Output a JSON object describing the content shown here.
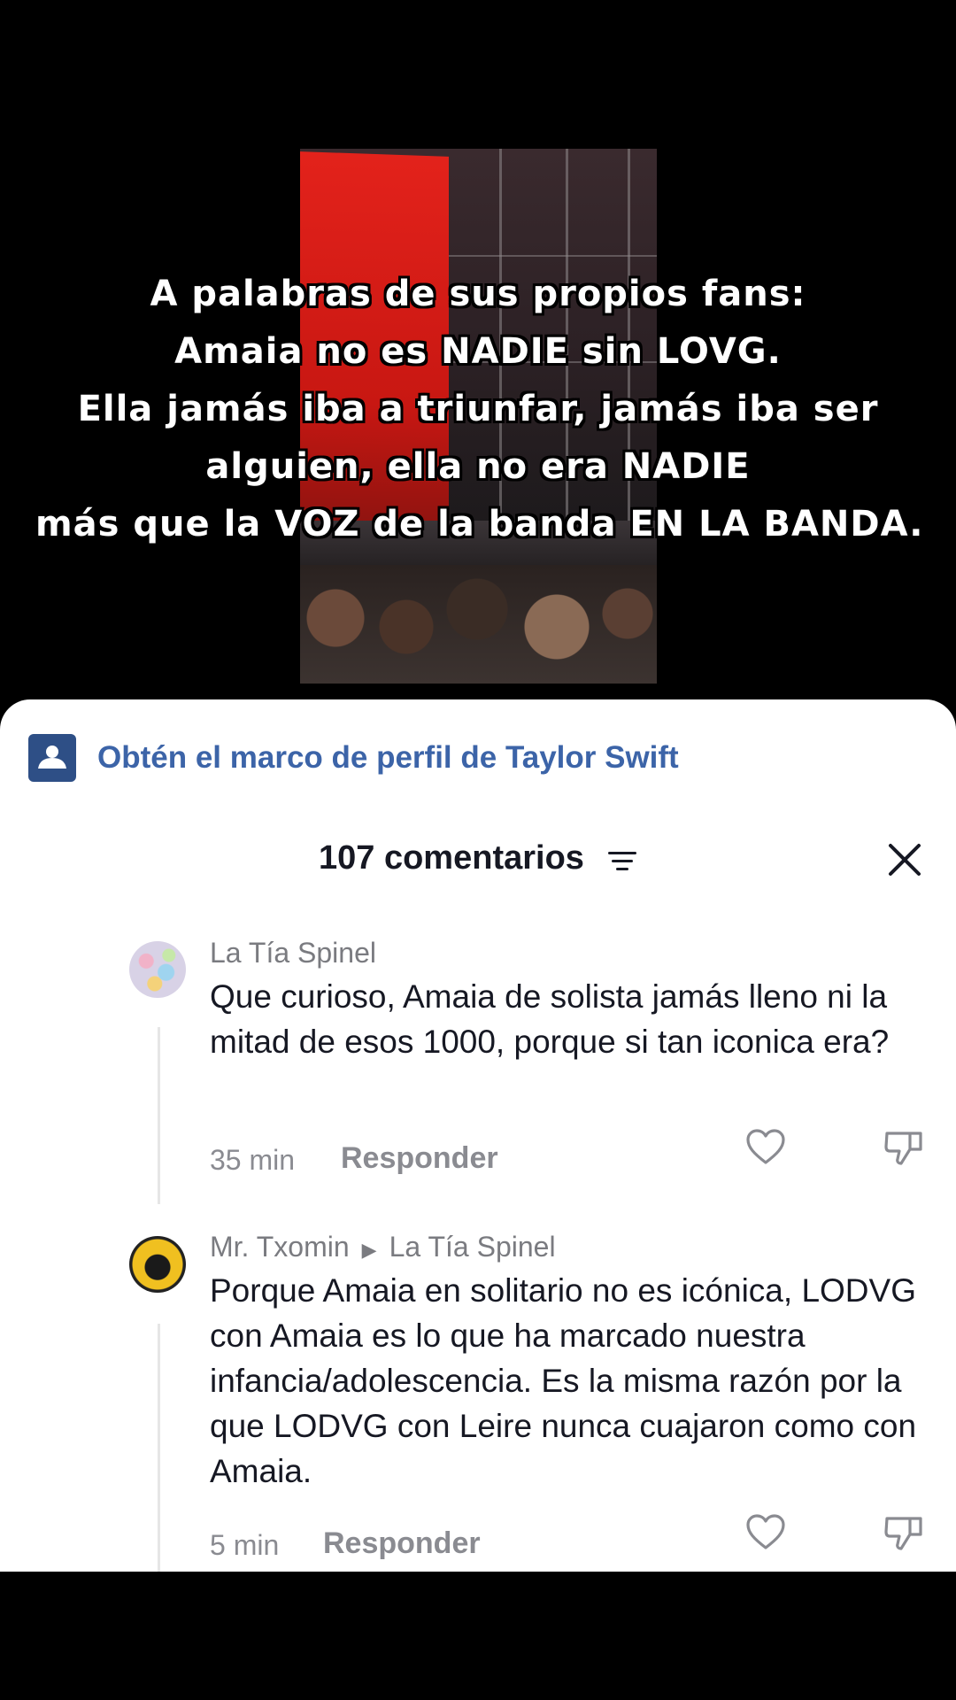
{
  "video": {
    "overlay_lines": [
      "A palabras de sus propios fans:",
      "Amaia no es NADIE sin LOVG.",
      "Ella jamás iba a triunfar, jamás iba ser",
      "alguien, ella no era NADIE",
      "más que la VOZ de la banda EN LA BANDA."
    ]
  },
  "promo": {
    "icon": "profile-frame-icon",
    "text": "Obtén el marco de perfil de Taylor Swift"
  },
  "header": {
    "title": "107 comentarios",
    "filter_icon": "filter-icon",
    "close_icon": "close-icon"
  },
  "comments": [
    {
      "username": "La Tía Spinel",
      "text": "Que curioso, Amaia de solista jamás lleno ni la mitad de esos 1000, porque si tan iconica era?",
      "time": "35 min",
      "reply_label": "Responder"
    },
    {
      "username": "Mr. Txomin",
      "reply_to": "La Tía Spinel",
      "text": "Porque Amaia en solitario no es icónica, LODVG con Amaia es lo que ha marcado nuestra infancia/adolescencia. Es la misma razón por la que LODVG con Leire nunca cuajaron como con Amaia.",
      "time": "5 min",
      "reply_label": "Responder"
    }
  ],
  "colors": {
    "promo_text": "#3c64a8",
    "promo_icon_bg": "#2e4f86",
    "primary_text": "#161823",
    "secondary_text": "#7a7b80"
  }
}
